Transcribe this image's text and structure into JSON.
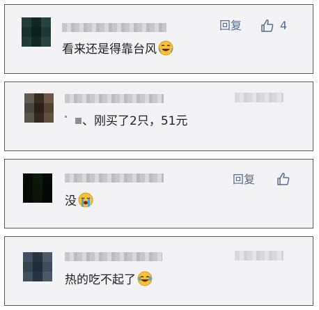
{
  "comments": [
    {
      "text": "看来还是得靠台风",
      "emoji": "rolling-laughing-emoji",
      "reply_label": "回复",
      "like_count": "4"
    },
    {
      "text": "、刚买了2只，51元",
      "reply_label": "",
      "like_count": ""
    },
    {
      "text": "没",
      "emoji": "crying-emoji",
      "reply_label": "回复"
    },
    {
      "text": "热的吃不起了",
      "emoji": "tears-of-joy-emoji",
      "reply_label": ""
    }
  ],
  "colors": {
    "card_bg": "#f3f3f5",
    "card_border": "#5a5a5a",
    "link_blue": "#576b95",
    "text": "#222222"
  }
}
